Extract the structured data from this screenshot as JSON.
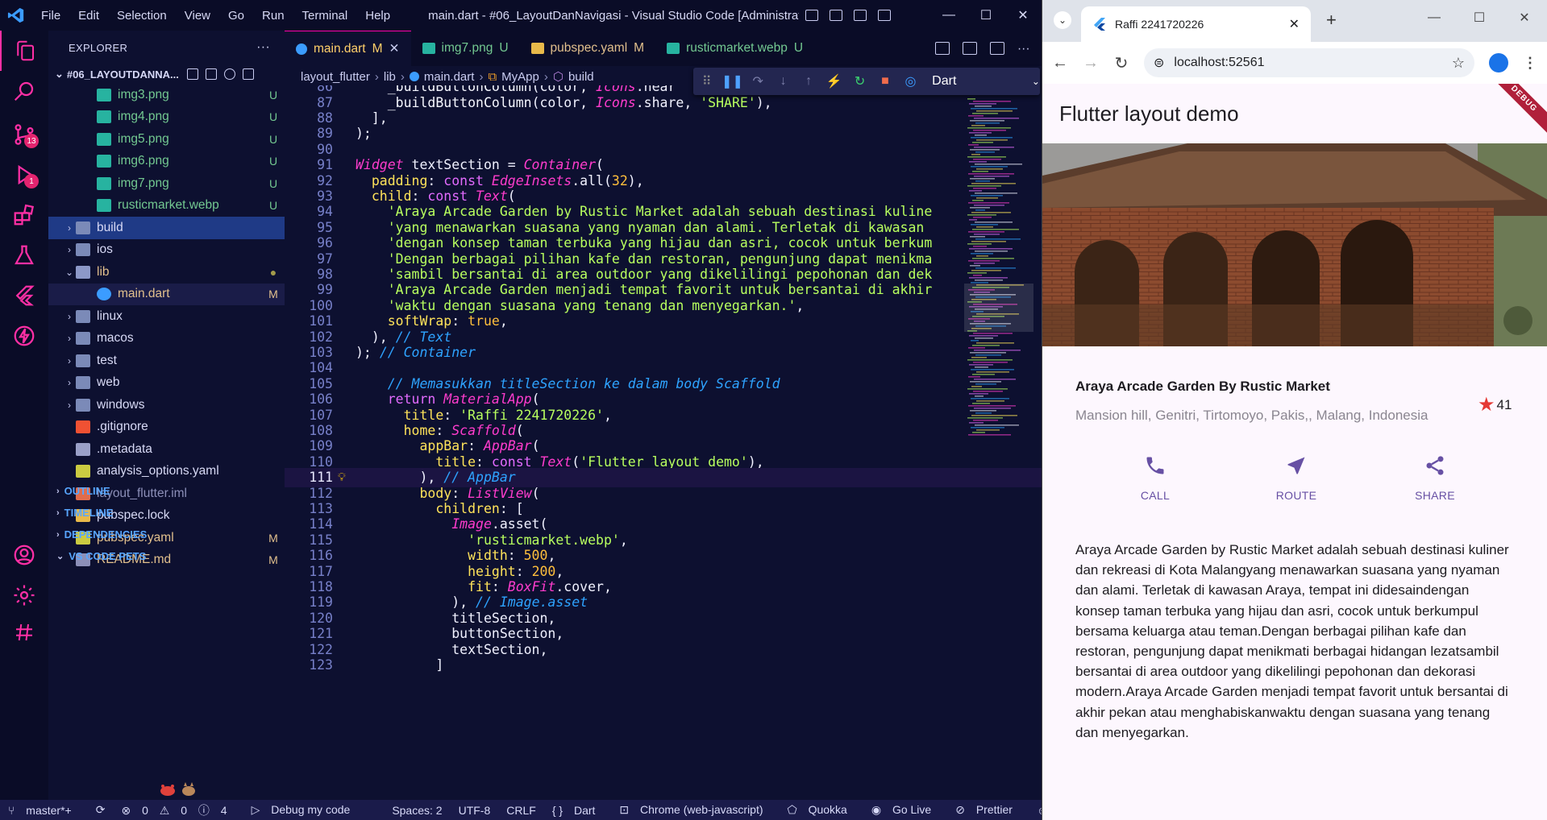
{
  "vscode": {
    "menu": [
      "File",
      "Edit",
      "Selection",
      "View",
      "Go",
      "Run",
      "Terminal",
      "Help"
    ],
    "window_title": "main.dart - #06_LayoutDanNavigasi - Visual Studio Code [Administrat...",
    "activity_badges": {
      "source_control": "13",
      "run_debug": "1"
    },
    "explorer": {
      "header": "EXPLORER",
      "project": "#06_LAYOUTDANNA...",
      "files": [
        {
          "name": "img3.png",
          "status": "U",
          "type": "image",
          "indent": 1
        },
        {
          "name": "img4.png",
          "status": "U",
          "type": "image",
          "indent": 1
        },
        {
          "name": "img5.png",
          "status": "U",
          "type": "image",
          "indent": 1
        },
        {
          "name": "img6.png",
          "status": "U",
          "type": "image",
          "indent": 1
        },
        {
          "name": "img7.png",
          "status": "U",
          "type": "image",
          "indent": 1
        },
        {
          "name": "rusticmarket.webp",
          "status": "U",
          "type": "image",
          "indent": 1
        },
        {
          "name": "build",
          "status": "",
          "type": "folder",
          "indent": 0
        },
        {
          "name": "ios",
          "status": "",
          "type": "folder",
          "indent": 0
        },
        {
          "name": "lib",
          "status": "●",
          "type": "folder-open",
          "indent": 0
        },
        {
          "name": "main.dart",
          "status": "M",
          "type": "dart",
          "indent": 1
        },
        {
          "name": "linux",
          "status": "",
          "type": "folder",
          "indent": 0
        },
        {
          "name": "macos",
          "status": "",
          "type": "folder",
          "indent": 0
        },
        {
          "name": "test",
          "status": "",
          "type": "folder",
          "indent": 0
        },
        {
          "name": "web",
          "status": "",
          "type": "folder",
          "indent": 0
        },
        {
          "name": "windows",
          "status": "",
          "type": "folder",
          "indent": 0
        },
        {
          "name": ".gitignore",
          "status": "",
          "type": "git",
          "indent": 0
        },
        {
          "name": ".metadata",
          "status": "",
          "type": "meta",
          "indent": 0
        },
        {
          "name": "analysis_options.yaml",
          "status": "",
          "type": "yaml",
          "indent": 0
        },
        {
          "name": "layout_flutter.iml",
          "status": "",
          "type": "iml",
          "indent": 0
        },
        {
          "name": "pubspec.lock",
          "status": "",
          "type": "lock",
          "indent": 0
        },
        {
          "name": "pubspec.yaml",
          "status": "M",
          "type": "yaml",
          "indent": 0
        },
        {
          "name": "README.md",
          "status": "M",
          "type": "md",
          "indent": 0
        }
      ],
      "sections": [
        "OUTLINE",
        "TIMELINE",
        "DEPENDENCIES",
        "VS CODE PETS"
      ]
    },
    "tabs": [
      {
        "name": "main.dart",
        "status": "M",
        "active": true
      },
      {
        "name": "img7.png",
        "status": "U",
        "active": false
      },
      {
        "name": "pubspec.yaml",
        "status": "M",
        "active": false
      },
      {
        "name": "rusticmarket.webp",
        "status": "U",
        "active": false
      }
    ],
    "breadcrumb": [
      "layout_flutter",
      "lib",
      "main.dart",
      "MyApp",
      "build"
    ],
    "debug_target": "Dart",
    "code_lines": [
      {
        "n": "86",
        "html": "    <span class='fn'>_buildButtonColumn</span><span class='pl'>(color, </span><span class='ty'>Icons</span><span class='pl'>.near</span>"
      },
      {
        "n": "87",
        "html": "    <span class='fn'>_buildButtonColumn</span><span class='pl'>(color, </span><span class='ty'>Icons</span><span class='pl'>.share, </span><span class='str'>'SHARE'</span><span class='pl'>),</span>"
      },
      {
        "n": "88",
        "html": "  <span class='pl'>],</span>"
      },
      {
        "n": "89",
        "html": "<span class='pl'>);</span>"
      },
      {
        "n": "90",
        "html": ""
      },
      {
        "n": "91",
        "html": "<span class='ty'>Widget</span> <span class='pl'>textSection = </span><span class='ty'>Container</span><span class='pl'>(</span>"
      },
      {
        "n": "92",
        "html": "  <span class='prop'>padding</span><span class='pl'>: </span><span class='kw'>const</span> <span class='ty'>EdgeInsets</span><span class='pl'>.all(</span><span class='num'>32</span><span class='pl'>),</span>"
      },
      {
        "n": "93",
        "html": "  <span class='prop'>child</span><span class='pl'>: </span><span class='kw'>const</span> <span class='ty'>Text</span><span class='pl'>(</span>"
      },
      {
        "n": "94",
        "html": "    <span class='str'>'Araya Arcade Garden by Rustic Market adalah sebuah destinasi kuline</span>"
      },
      {
        "n": "95",
        "html": "    <span class='str'>'yang menawarkan suasana yang nyaman dan alami. Terletak di kawasan</span>"
      },
      {
        "n": "96",
        "html": "    <span class='str'>'dengan konsep taman terbuka yang hijau dan asri, cocok untuk berkum</span>"
      },
      {
        "n": "97",
        "html": "    <span class='str'>'Dengan berbagai pilihan kafe dan restoran, pengunjung dapat menikma</span>"
      },
      {
        "n": "98",
        "html": "    <span class='str'>'sambil bersantai di area outdoor yang dikelilingi pepohonan dan dek</span>"
      },
      {
        "n": "99",
        "html": "    <span class='str'>'Araya Arcade Garden menjadi tempat favorit untuk bersantai di akhir</span>"
      },
      {
        "n": "100",
        "html": "    <span class='str'>'waktu dengan suasana yang tenang dan menyegarkan.'</span><span class='pl'>,</span>"
      },
      {
        "n": "101",
        "html": "    <span class='prop'>softWrap</span><span class='pl'>: </span><span class='bool'>true</span><span class='pl'>,</span>"
      },
      {
        "n": "102",
        "html": "  <span class='pl'>), </span><span class='cm'>// Text</span>"
      },
      {
        "n": "103",
        "html": "<span class='pl'>); </span><span class='cm'>// Container</span>"
      },
      {
        "n": "104",
        "html": ""
      },
      {
        "n": "105",
        "html": "    <span class='cm'>// Memasukkan titleSection ke dalam body Scaffold</span>"
      },
      {
        "n": "106",
        "html": "    <span class='kw'>return</span> <span class='ty'>MaterialApp</span><span class='pl'>(</span>"
      },
      {
        "n": "107",
        "html": "      <span class='prop'>title</span><span class='pl'>: </span><span class='str'>'Raffi 2241720226'</span><span class='pl'>,</span>"
      },
      {
        "n": "108",
        "html": "      <span class='prop'>home</span><span class='pl'>: </span><span class='ty'>Scaffold</span><span class='pl'>(</span>"
      },
      {
        "n": "109",
        "html": "        <span class='prop'>appBar</span><span class='pl'>: </span><span class='ty'>AppBar</span><span class='pl'>(</span>"
      },
      {
        "n": "110",
        "html": "          <span class='prop'>title</span><span class='pl'>: </span><span class='kw'>const</span> <span class='ty'>Text</span><span class='pl'>(</span><span class='str'>'Flutter layout demo'</span><span class='pl'>),</span>"
      },
      {
        "n": "111",
        "html": "        <span class='pl'>), </span><span class='cm'>// AppBar</span>"
      },
      {
        "n": "112",
        "html": "        <span class='prop'>body</span><span class='pl'>: </span><span class='ty'>ListView</span><span class='pl'>(</span>"
      },
      {
        "n": "113",
        "html": "          <span class='prop'>children</span><span class='pl'>: [</span>"
      },
      {
        "n": "114",
        "html": "            <span class='ty'>Image</span><span class='pl'>.asset(</span>"
      },
      {
        "n": "115",
        "html": "              <span class='str'>'rusticmarket.webp'</span><span class='pl'>,</span>"
      },
      {
        "n": "116",
        "html": "              <span class='prop'>width</span><span class='pl'>: </span><span class='num'>500</span><span class='pl'>,</span>"
      },
      {
        "n": "117",
        "html": "              <span class='prop'>height</span><span class='pl'>: </span><span class='num'>200</span><span class='pl'>,</span>"
      },
      {
        "n": "118",
        "html": "              <span class='prop'>fit</span><span class='pl'>: </span><span class='ty'>BoxFit</span><span class='pl'>.cover,</span>"
      },
      {
        "n": "119",
        "html": "            <span class='pl'>), </span><span class='cm'>// Image.asset</span>"
      },
      {
        "n": "120",
        "html": "            <span class='pl'>titleSection,</span>"
      },
      {
        "n": "121",
        "html": "            <span class='pl'>buttonSection,</span>"
      },
      {
        "n": "122",
        "html": "            <span class='pl'>textSection,</span>"
      },
      {
        "n": "123",
        "html": "          <span class='pl'>]</span>"
      }
    ],
    "current_line": "111",
    "status": {
      "branch": "master*+",
      "errors": "0",
      "warnings": "0",
      "info": "4",
      "debug": "Debug my code",
      "spaces": "Spaces: 2",
      "encoding": "UTF-8",
      "eol": "CRLF",
      "lang": "Dart",
      "device": "Chrome (web-javascript)",
      "quokka": "Quokka",
      "golive": "Go Live",
      "prettier": "Prettier"
    }
  },
  "browser": {
    "tab_title": "Raffi 2241720226",
    "url": "localhost:52561",
    "app": {
      "appbar_title": "Flutter layout demo",
      "debug_banner": "DEBUG",
      "place_name": "Araya Arcade Garden By Rustic Market",
      "place_location": "Mansion hill, Genitri, Tirtomoyo, Pakis,, Malang, Indonesia",
      "rating": "41",
      "actions": [
        "CALL",
        "ROUTE",
        "SHARE"
      ],
      "description": "Araya Arcade Garden by Rustic Market adalah sebuah destinasi kuliner dan rekreasi di Kota Malangyang menawarkan suasana yang nyaman dan alami. Terletak di kawasan Araya, tempat ini didesaindengan konsep taman terbuka yang hijau dan asri, cocok untuk berkumpul bersama keluarga atau teman.Dengan berbagai pilihan kafe dan restoran, pengunjung dapat menikmati berbagai hidangan lezatsambil bersantai di area outdoor yang dikelilingi pepohonan dan dekorasi modern.Araya Arcade Garden menjadi tempat favorit untuk bersantai di akhir pekan atau menghabiskanwaktu dengan suasana yang tenang dan menyegarkan."
    }
  },
  "colors": {
    "accent_primary": "#6750a4",
    "star": "#e53935",
    "editor_bg": "#0d1030",
    "vscode_blue": "#3b9cff"
  }
}
